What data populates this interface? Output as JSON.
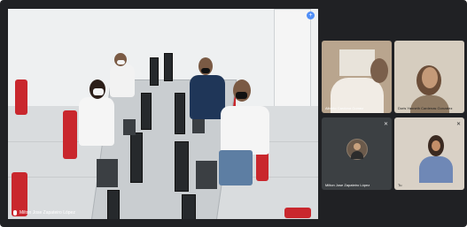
{
  "main_tile": {
    "name": "Milton Jose Zapateiro López"
  },
  "participants": [
    {
      "name": "Alberto Cardona Gomez"
    },
    {
      "name": "Doris Yanneth Cardenas Gonzalez"
    },
    {
      "name": "Milton Jose Zapateiro López"
    },
    {
      "name": "Tu"
    }
  ],
  "icons": {
    "pin": "pin-icon",
    "mic_off": "mic-off-icon"
  },
  "colors": {
    "background": "#202124",
    "pin_accent": "#4f8ef7"
  }
}
